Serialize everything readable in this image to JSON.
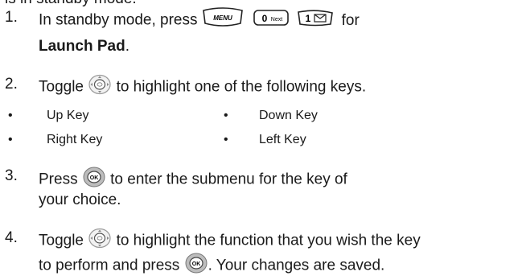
{
  "intro_fragment": "is in standby mode.",
  "steps": [
    {
      "num": "1.",
      "before": "In standby mode, press",
      "after": "for",
      "bold": "Launch Pad",
      "bold_suffix": ".",
      "keys": [
        {
          "icon": "menu-key-icon",
          "label": "MENU"
        },
        {
          "icon": "zero-next-key-icon",
          "digit": "0",
          "label": "Next"
        },
        {
          "icon": "one-message-key-icon",
          "digit": "1"
        }
      ]
    },
    {
      "num": "2.",
      "before": "Toggle",
      "after": "to highlight one of the following keys.",
      "icon": "navigation-key-icon"
    },
    {
      "num": "3.",
      "before": "Press",
      "after": "to enter the submenu for the key of",
      "line2": "your choice.",
      "icon": "ok-key-icon"
    },
    {
      "num": "4.",
      "before": "Toggle",
      "after": "to highlight the function that you wish the key",
      "line2_before": "to perform and press",
      "line2_after": ". Your changes are saved.",
      "icons": [
        "navigation-key-icon",
        "ok-key-icon"
      ]
    }
  ],
  "bullets": {
    "left": [
      "Up Key",
      "Right Key"
    ],
    "right": [
      "Down Key",
      "Left Key"
    ],
    "marker": "•"
  },
  "icons": {
    "ok_label": "OK"
  }
}
